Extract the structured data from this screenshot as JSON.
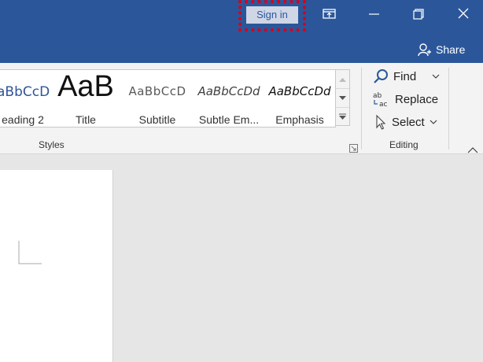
{
  "titlebar": {
    "sign_in_label": "Sign in",
    "share_label": "Share",
    "window_buttons": [
      "ribbon-display-icon",
      "minimize-icon",
      "restore-icon",
      "close-icon"
    ]
  },
  "ribbon": {
    "styles": [
      {
        "preview": "aBbCcD",
        "label": "eading 2"
      },
      {
        "preview": "AaB",
        "label": "Title"
      },
      {
        "preview": "AaBbCcD",
        "label": "Subtitle"
      },
      {
        "preview": "AaBbCcDd",
        "label": "Subtle Em..."
      },
      {
        "preview": "AaBbCcDd",
        "label": "Emphasis"
      }
    ],
    "styles_group_label": "Styles",
    "editing": {
      "find_label": "Find",
      "replace_label": "Replace",
      "select_label": "Select",
      "group_label": "Editing"
    }
  },
  "colors": {
    "titlebar": "#2b579a",
    "highlight": "#d8001a"
  }
}
